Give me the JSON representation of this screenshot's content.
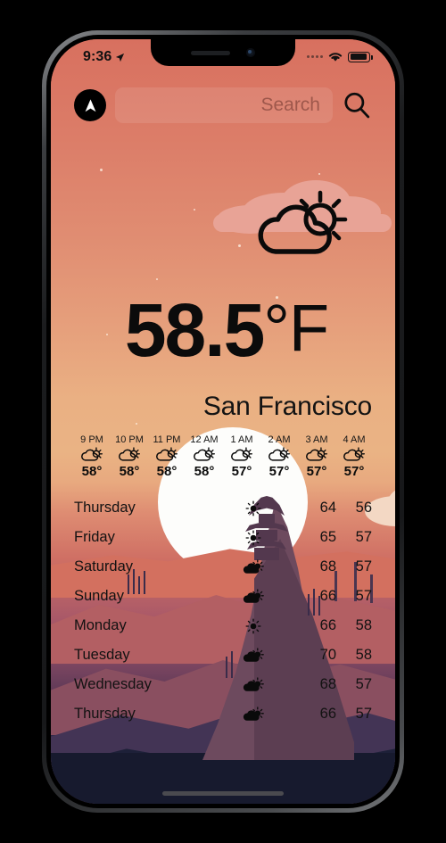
{
  "status_bar": {
    "time": "9:36",
    "location_arrow_icon": "location-arrow-icon",
    "signal_icon": "signal-dots-icon",
    "wifi_icon": "wifi-icon",
    "battery_icon": "battery-icon"
  },
  "search": {
    "location_button_icon": "navigation-arrow-icon",
    "placeholder": "Search",
    "value": "",
    "search_icon": "magnifier-icon"
  },
  "current": {
    "condition_icon": "partly-cloudy-icon",
    "temperature": "58.5",
    "unit": "°F",
    "city": "San Francisco"
  },
  "hourly": [
    {
      "time": "9 PM",
      "icon": "partly-cloudy-icon",
      "temp": "58°"
    },
    {
      "time": "10 PM",
      "icon": "partly-cloudy-icon",
      "temp": "58°"
    },
    {
      "time": "11 PM",
      "icon": "partly-cloudy-icon",
      "temp": "58°"
    },
    {
      "time": "12 AM",
      "icon": "partly-cloudy-icon",
      "temp": "58°"
    },
    {
      "time": "1 AM",
      "icon": "partly-cloudy-icon",
      "temp": "57°"
    },
    {
      "time": "2 AM",
      "icon": "partly-cloudy-icon",
      "temp": "57°"
    },
    {
      "time": "3 AM",
      "icon": "partly-cloudy-icon",
      "temp": "57°"
    },
    {
      "time": "4 AM",
      "icon": "partly-cloudy-icon",
      "temp": "57°"
    }
  ],
  "daily": [
    {
      "day": "Thursday",
      "icon": "sun-icon",
      "high": "64",
      "low": "56"
    },
    {
      "day": "Friday",
      "icon": "sun-icon",
      "high": "65",
      "low": "57"
    },
    {
      "day": "Saturday",
      "icon": "partly-cloudy-icon",
      "high": "68",
      "low": "57"
    },
    {
      "day": "Sunday",
      "icon": "partly-cloudy-icon",
      "high": "66",
      "low": "57"
    },
    {
      "day": "Monday",
      "icon": "sun-icon",
      "high": "66",
      "low": "58"
    },
    {
      "day": "Tuesday",
      "icon": "partly-cloudy-icon",
      "high": "70",
      "low": "58"
    },
    {
      "day": "Wednesday",
      "icon": "partly-cloudy-icon",
      "high": "68",
      "low": "57"
    },
    {
      "day": "Thursday",
      "icon": "partly-cloudy-icon",
      "high": "66",
      "low": "57"
    }
  ],
  "colors": {
    "sky_top": "#d8705f",
    "sky_mid": "#eab384",
    "sky_bottom": "#171a2e",
    "text": "#121212",
    "sun_disc": "#fdfdfb"
  }
}
